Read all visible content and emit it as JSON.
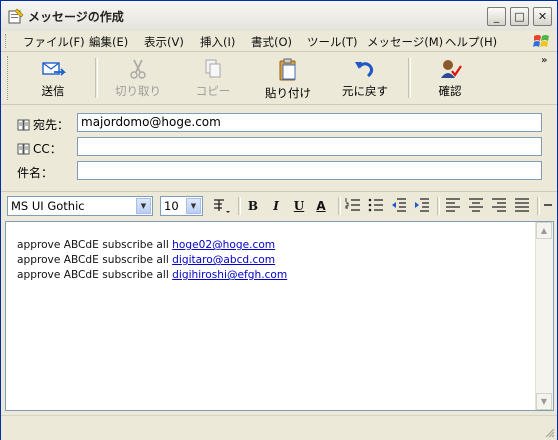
{
  "window": {
    "title": "メッセージの作成",
    "controls": {
      "minimize": "_",
      "maximize": "□",
      "close": "✕"
    }
  },
  "menu": [
    "ファイル(F)",
    "編集(E)",
    "表示(V)",
    "挿入(I)",
    "書式(O)",
    "ツール(T)",
    "メッセージ(M)",
    "ヘルプ(H)"
  ],
  "toolbar": {
    "send": "送信",
    "cut": "切り取り",
    "copy": "コピー",
    "paste": "貼り付け",
    "undo": "元に戻す",
    "check": "確認",
    "overflow": "»"
  },
  "headers": {
    "to": {
      "label": "宛先：",
      "value": "majordomo@hoge.com"
    },
    "cc": {
      "label": "CC：",
      "value": ""
    },
    "subject": {
      "label": "件名：",
      "value": ""
    }
  },
  "format": {
    "font": "MS UI Gothic",
    "size": "10",
    "bold": "B",
    "italic": "I",
    "underline": "U",
    "font_color": "A"
  },
  "body": {
    "lines": [
      {
        "text": "approve ABCdE subscribe all ",
        "link": "hoge02@hoge.com"
      },
      {
        "text": "approve ABCdE subscribe all ",
        "link": "digitaro@abcd.com"
      },
      {
        "text": "approve ABCdE subscribe all ",
        "link": "digihiroshi@efgh.com"
      }
    ]
  },
  "colors": {
    "window_border": "#002ea8",
    "link": "#0000cc",
    "send_icon": "#1b5fd0",
    "undo_icon": "#1c58c8"
  }
}
